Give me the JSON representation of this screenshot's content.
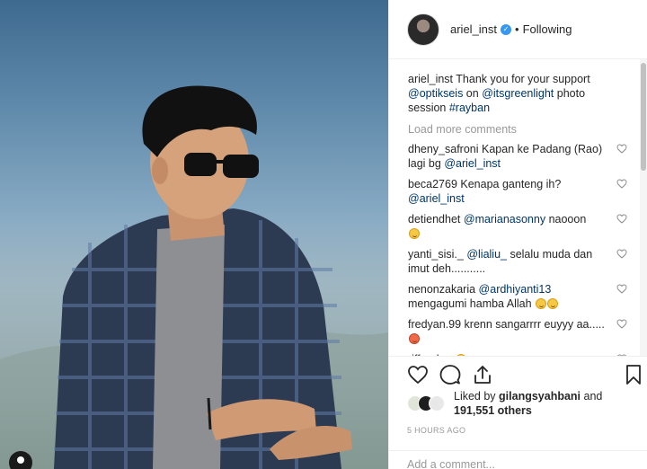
{
  "post": {
    "username": "ariel_inst",
    "follow_separator": "•",
    "follow_status": "Following"
  },
  "caption": {
    "username": "ariel_inst",
    "text_1": " Thank you for your support ",
    "mention_1": "@optikseis",
    "text_2": " on ",
    "mention_2": "@itsgreenlight",
    "text_3": " photo session ",
    "hashtag": "#rayban"
  },
  "load_more": "Load more comments",
  "comments": [
    {
      "user": "dheny_safroni",
      "text": " Kapan ke Padang (Rao) lagi bg ",
      "mention": "@ariel_inst",
      "after": ""
    },
    {
      "user": "beca2769",
      "text": " Kenapa ganteng ih? ",
      "mention": "@ariel_inst",
      "after": ""
    },
    {
      "user": "detiendhet",
      "text": " ",
      "mention": "@marianasonny",
      "after": " naooon"
    },
    {
      "user": "yanti_sisi._",
      "text": " ",
      "mention": "@lialiu_",
      "after": " selalu muda dan imut deh..........."
    },
    {
      "user": "nenonzakaria",
      "text": " ",
      "mention": "@ardhiyanti13",
      "after": " mengagumi hamba Allah"
    },
    {
      "user": "fredyan.99",
      "text": " krenn sangarrrr euyyy aa.....",
      "mention": "",
      "after": ""
    },
    {
      "user": "riffandoo",
      "text": " ",
      "mention": "",
      "after": ""
    }
  ],
  "likes": {
    "prefix": "Liked by ",
    "user": "gilangsyahbani",
    "middle": " and",
    "count": "191,551 others"
  },
  "timestamp": "5 HOURS AGO",
  "add_comment_placeholder": "Add a comment...",
  "icons": {
    "like": "heart-icon",
    "comment": "comment-icon",
    "share": "share-icon",
    "save": "bookmark-icon",
    "verified": "verified-badge-icon"
  },
  "colors": {
    "mention": "#003569",
    "muted": "#999999",
    "verified": "#3897f0"
  }
}
